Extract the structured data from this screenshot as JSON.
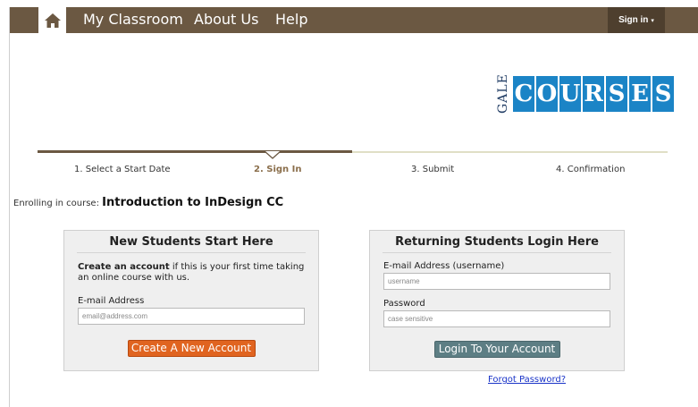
{
  "nav": {
    "home_icon": "home-icon",
    "items": [
      {
        "label": "My Classroom"
      },
      {
        "label": "About Us"
      },
      {
        "label": "Help"
      }
    ],
    "signin_label": "Sign in",
    "signin_caret": "▾"
  },
  "logo": {
    "gale": "GALE",
    "courses_letters": [
      "C",
      "O",
      "U",
      "R",
      "S",
      "E",
      "S"
    ],
    "brand_color": "#1b84c6"
  },
  "steps": [
    {
      "label": "1. Select a Start Date"
    },
    {
      "label": "2. Sign In"
    },
    {
      "label": "3. Submit"
    },
    {
      "label": "4. Confirmation"
    }
  ],
  "enrolling": {
    "prefix": "Enrolling in course: ",
    "course": "Introduction to InDesign CC"
  },
  "new_students": {
    "title": "New Students Start Here",
    "desc_bold": "Create an account",
    "desc_rest": " if this is your first time taking an online course with us.",
    "email_label": "E-mail Address",
    "email_placeholder": "email@address.com",
    "button": "Create A New Account"
  },
  "returning": {
    "title": "Returning Students Login Here",
    "email_label": "E-mail Address (username)",
    "email_placeholder": "username",
    "password_label": "Password",
    "password_placeholder": "case sensitive",
    "button": "Login To Your Account"
  },
  "forgot": "Forgot Password?",
  "colors": {
    "nav_bg": "#6b5842",
    "active_step": "#8a6e4b",
    "create_button": "#e06420",
    "login_button": "#5d7e84"
  }
}
